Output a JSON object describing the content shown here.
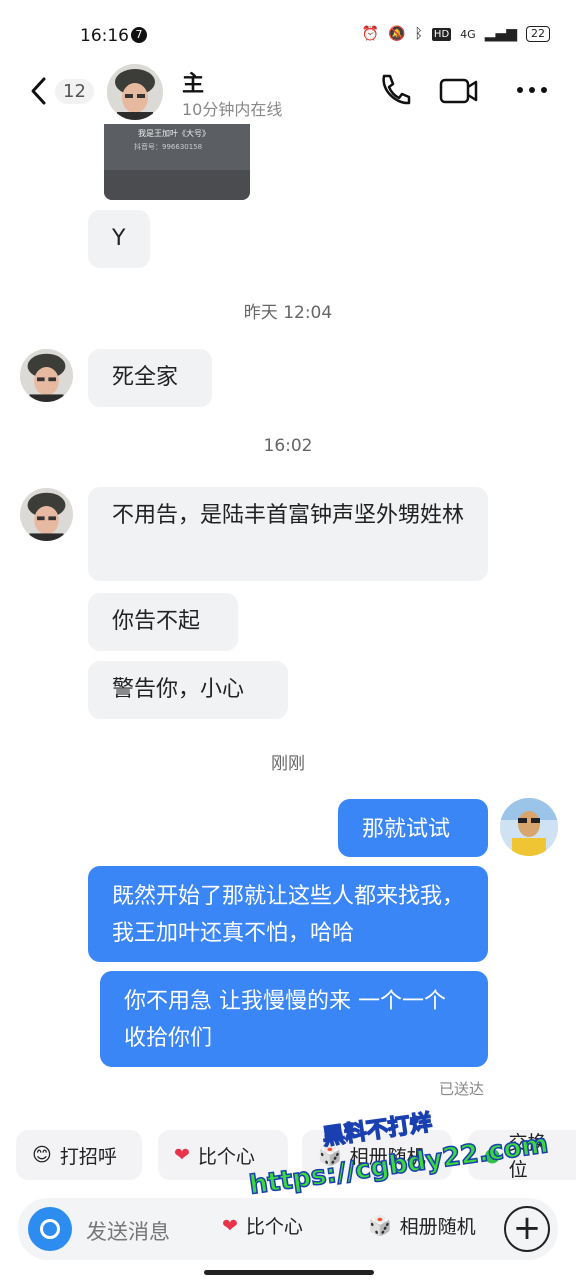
{
  "status_bar": {
    "time": "16:16",
    "notification_count": "7",
    "network": "4G",
    "battery": "22"
  },
  "header": {
    "unread_count": "12",
    "contact_name": "主",
    "contact_status": "10分钟内在线"
  },
  "preview_card": {
    "title": "我是王加叶《大号》",
    "subtitle": "抖音号：996630158"
  },
  "messages": [
    {
      "dir": "in",
      "text": "Y"
    },
    {
      "type": "time",
      "text": "昨天 12:04"
    },
    {
      "dir": "in",
      "text": "死全家"
    },
    {
      "type": "time",
      "text": "16:02"
    },
    {
      "dir": "in",
      "text": "不用告，是陆丰首富钟声坚外甥姓林"
    },
    {
      "dir": "in",
      "text": "你告不起"
    },
    {
      "dir": "in",
      "text": "警告你，小心"
    },
    {
      "type": "time",
      "text": "刚刚"
    },
    {
      "dir": "out",
      "text": "那就试试"
    },
    {
      "dir": "out",
      "text": "既然开始了那就让这些人都来找我，我王加叶还真不怕，哈哈"
    },
    {
      "dir": "out",
      "text": "你不用急 让我慢慢的来 一个一个收拾你们"
    }
  ],
  "delivered_label": "已送达",
  "quick_actions": [
    "打招呼",
    "比个心",
    "相册随机",
    "交换位"
  ],
  "input": {
    "placeholder": "发送消息",
    "chips": [
      "比个心",
      "相册随机"
    ]
  },
  "watermark": {
    "line1": "黑料不打烊",
    "line2": "https://cgbdy22.com"
  },
  "colors": {
    "outgoing_bubble": "#3a86f7",
    "incoming_bubble": "#f1f2f4",
    "camera_button": "#2d8cf0",
    "location_pin": "#2ec24a",
    "heart": "#e8344a"
  }
}
